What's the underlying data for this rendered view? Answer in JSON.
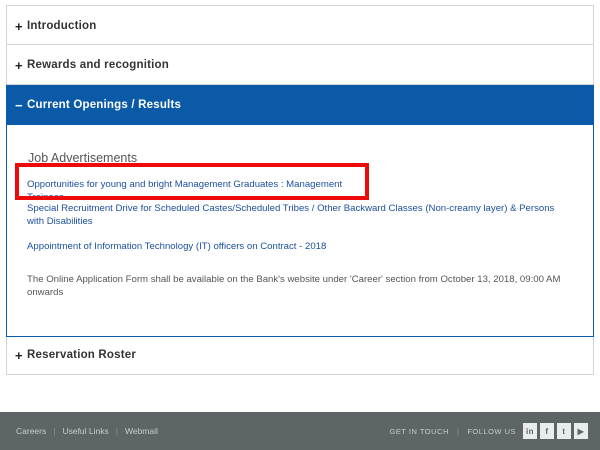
{
  "accordion": {
    "sections": [
      {
        "label": "Introduction",
        "sign": "+"
      },
      {
        "label": "Rewards and recognition",
        "sign": "+"
      },
      {
        "label": "Current Openings / Results",
        "sign": "−"
      },
      {
        "label": "Reservation Roster",
        "sign": "+"
      }
    ],
    "current_openings": {
      "title": "Job Advertisements",
      "links": [
        "Opportunities for young and bright Management Graduates : Management Trainees",
        "Special Recruitment Drive for Scheduled Castes/Scheduled Tribes / Other Backward Classes (Non-creamy layer) & Persons with Disabilities",
        "Appointment of Information Technology (IT) officers on Contract - 2018"
      ],
      "note": "The Online Application Form shall be available on the Bank's website under 'Career' section from October 13, 2018, 09:00 AM onwards"
    }
  },
  "annotation": {
    "highlight_color": "#ef0a0a"
  },
  "footer": {
    "links": [
      "Careers",
      "Useful Links",
      "Webmail"
    ],
    "get_in_touch": "GET IN TOUCH",
    "follow_us": "FOLLOW US",
    "social": [
      {
        "icon": "linkedin-icon",
        "glyph": "in"
      },
      {
        "icon": "facebook-icon",
        "glyph": "f"
      },
      {
        "icon": "twitter-icon",
        "glyph": "t"
      },
      {
        "icon": "youtube-icon",
        "glyph": "▶"
      }
    ]
  }
}
